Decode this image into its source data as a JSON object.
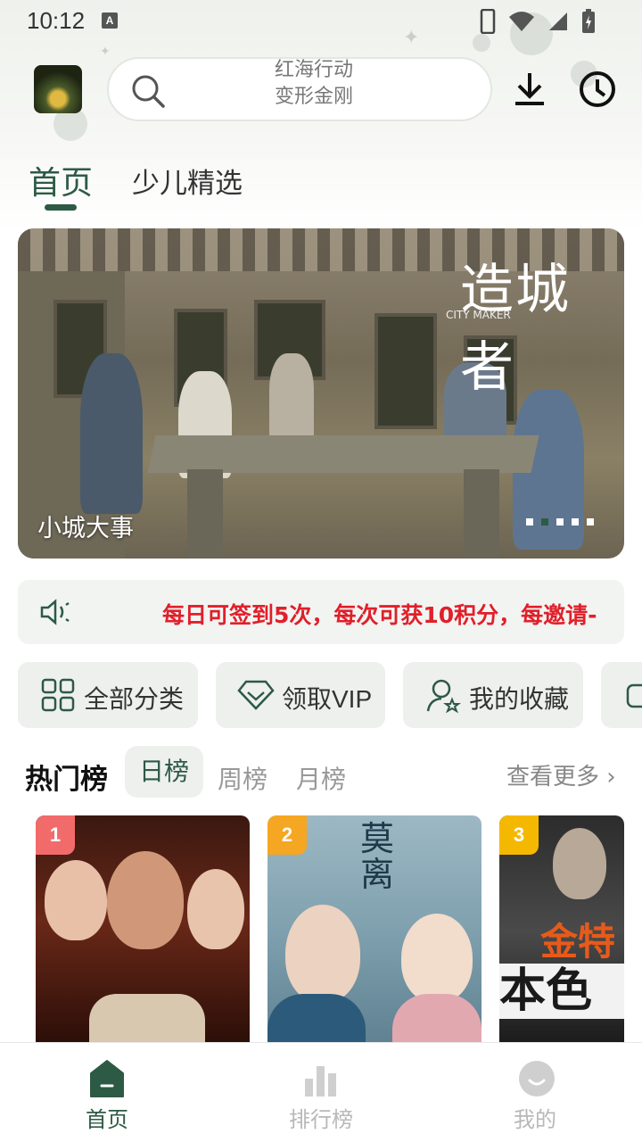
{
  "status_bar": {
    "time": "10:12",
    "notification_badge": "A"
  },
  "header": {
    "search_hint_lines": [
      "红海行动",
      "变形金刚"
    ]
  },
  "top_tabs": [
    {
      "label": "首页",
      "active": true
    },
    {
      "label": "少儿精选",
      "active": false
    }
  ],
  "banner": {
    "title_art": "造城者",
    "title_art_sub": "CITY MAKER",
    "caption": "小城大事",
    "dot_count": 5,
    "active_dot": 1
  },
  "notice": {
    "text": "每日可签到5次，每次可获10积分，每邀请-"
  },
  "quick_actions": [
    {
      "label": "全部分类",
      "icon": "grid-icon"
    },
    {
      "label": "领取VIP",
      "icon": "diamond-icon"
    },
    {
      "label": "我的收藏",
      "icon": "user-star-icon"
    }
  ],
  "hot_list": {
    "title": "热门榜",
    "tabs": [
      {
        "label": "日榜",
        "active": true
      },
      {
        "label": "周榜",
        "active": false
      },
      {
        "label": "月榜",
        "active": false
      }
    ],
    "see_more": "查看更多 ›",
    "items": [
      {
        "rank": "1",
        "badge_color": "#f26b6b"
      },
      {
        "rank": "2",
        "badge_color": "#f5a623",
        "poster_text": "莫离"
      },
      {
        "rank": "3",
        "badge_color": "#f5b800",
        "poster_text_lines": [
          "金特",
          "本色"
        ]
      }
    ]
  },
  "bottom_nav": [
    {
      "label": "首页",
      "icon": "home-icon",
      "active": true
    },
    {
      "label": "排行榜",
      "icon": "bar-chart-icon",
      "active": false
    },
    {
      "label": "我的",
      "icon": "smile-icon",
      "active": false
    }
  ],
  "colors": {
    "accent": "#2d5a45",
    "notice_red": "#e0202a"
  }
}
